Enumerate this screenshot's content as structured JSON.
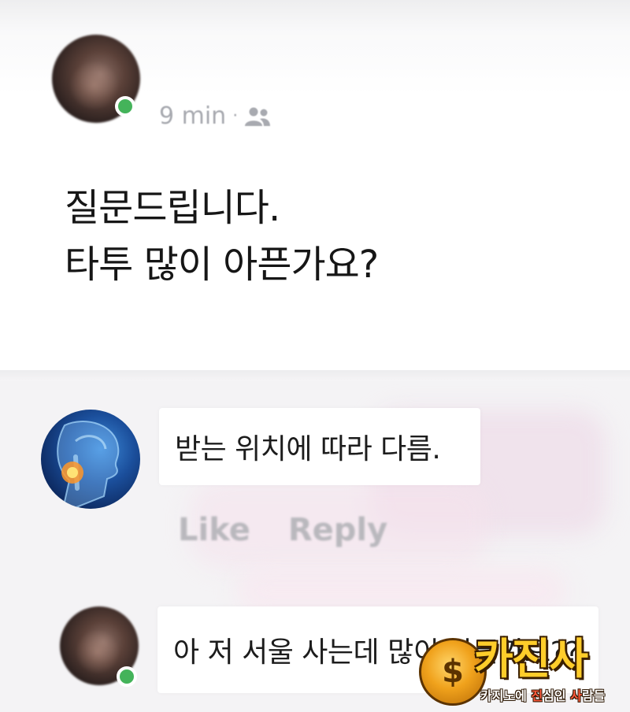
{
  "post": {
    "time": "9 min",
    "separator": "·",
    "audience_icon": "friends-icon",
    "text_line1": "질문드립니다.",
    "text_line2": "타투 많이 아픈가요?"
  },
  "comments": [
    {
      "text": "받는 위치에 따라 다름.",
      "avatar_icon": "throat-pain-illustration",
      "actions": {
        "like": "Like",
        "reply": "Reply"
      }
    },
    {
      "text": "아 저 서울 사는데 많이 아픈가요??",
      "avatar_icon": "person-avatar",
      "online": true
    }
  ],
  "watermark": {
    "logo_symbol": "$",
    "title": "카진사",
    "subtitle_pre": "카지노에 ",
    "subtitle_hl1": "진",
    "subtitle_mid1": "심인 ",
    "subtitle_hl2": "사",
    "subtitle_mid2": "람들"
  },
  "colors": {
    "online": "#44b35a",
    "muted_text": "#a8aab0",
    "action_text": "#b9b8bd",
    "watermark_gold": "#ffcd2a"
  }
}
